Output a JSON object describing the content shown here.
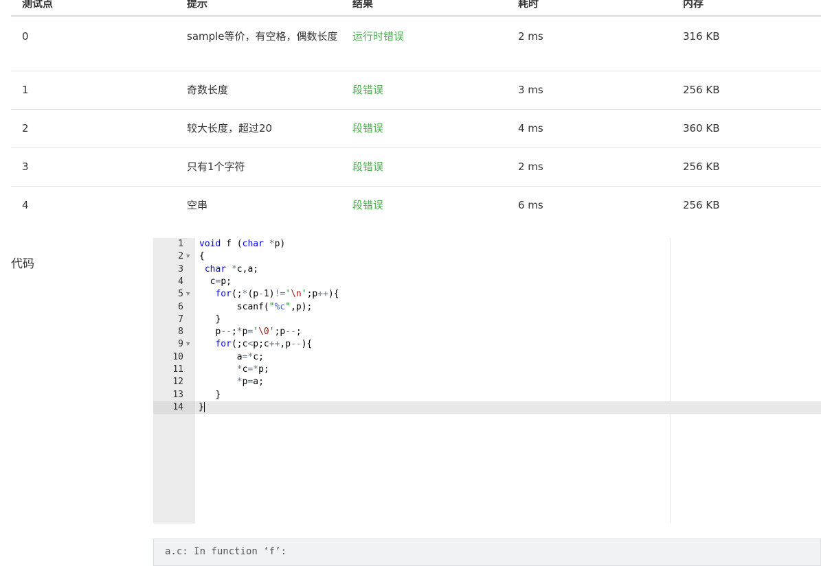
{
  "table": {
    "headers": [
      "测试点",
      "提示",
      "结果",
      "耗时",
      "内存"
    ],
    "rows": [
      {
        "id": "0",
        "hint": "sample等价，有空格，偶数长度",
        "result": "运行时错误",
        "time": "2 ms",
        "memory": "316 KB"
      },
      {
        "id": "1",
        "hint": "奇数长度",
        "result": "段错误",
        "time": "3 ms",
        "memory": "256 KB"
      },
      {
        "id": "2",
        "hint": "较大长度，超过20",
        "result": "段错误",
        "time": "4 ms",
        "memory": "360 KB"
      },
      {
        "id": "3",
        "hint": "只有1个字符",
        "result": "段错误",
        "time": "2 ms",
        "memory": "256 KB"
      },
      {
        "id": "4",
        "hint": "空串",
        "result": "段错误",
        "time": "6 ms",
        "memory": "256 KB"
      }
    ]
  },
  "code_section": {
    "label": "代码",
    "line_numbers": [
      "1",
      "2",
      "3",
      "4",
      "5",
      "6",
      "7",
      "8",
      "9",
      "10",
      "11",
      "12",
      "13",
      "14"
    ],
    "fold_lines": [
      2,
      5,
      9
    ],
    "active_line": 14
  },
  "compile_output": {
    "text": "a.c: In function ‘f’:"
  },
  "colors": {
    "result_text": "#4caf50",
    "gutter_bg": "#ebebeb",
    "keyword": "#0000ff",
    "string": "#008000"
  }
}
